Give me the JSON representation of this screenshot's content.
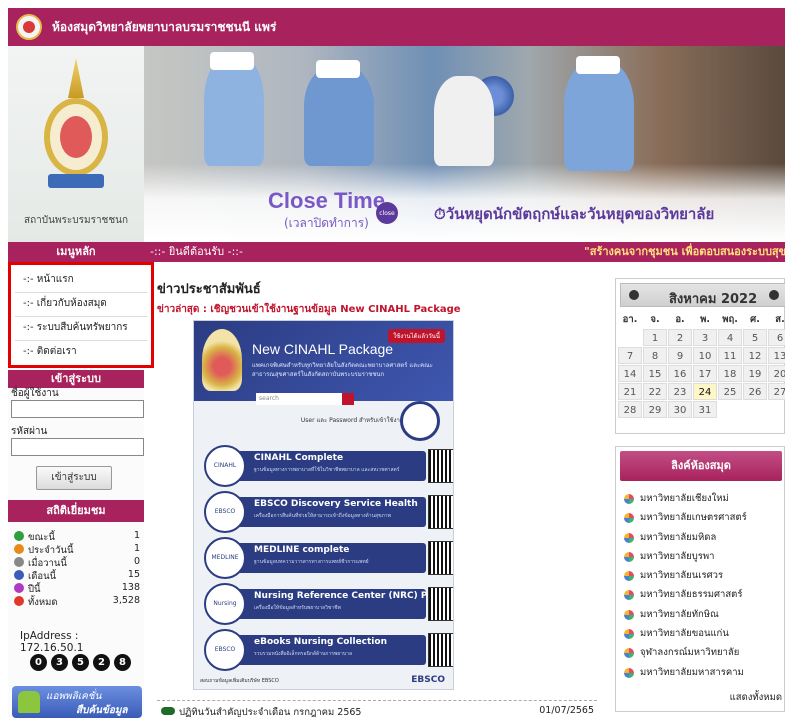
{
  "site": {
    "title": "ห้องสมุดวิทยาลัยพยาบาลบรมราชชนนี แพร่"
  },
  "banner": {
    "crest_caption": "สถาบันพระบรมราชชนก",
    "close_time": "Close Time",
    "close_time_sub": "(เวลาปิดทำการ)",
    "close_badge": "close",
    "holiday_text": "วันหยุดนักขัตฤกษ์และวันหยุดของวิทยาลัย"
  },
  "subbar": {
    "left_label": "เมนูหลัก",
    "welcome": "-::- ยินดีต้อนรับ -::-",
    "marquee": "\"สร้างคนจากชุมชน เพื่อตอบสนองระบบสุขภาพร"
  },
  "menu": {
    "items": [
      "-:- หน้าแรก",
      "-:- เกี่ยวกับห้องสมุด",
      "-:- ระบบสืบค้นทรัพยากร",
      "-:- ติดต่อเรา"
    ]
  },
  "login": {
    "header": "เข้าสู่ระบบ",
    "username_label": "ชื่อผู้ใช้งาน",
    "password_label": "รหัสผ่าน",
    "button": "เข้าสู่ระบบ"
  },
  "stats": {
    "header": "สถิติเยี่ยมชม",
    "rows": [
      {
        "label": "ขณะนี้",
        "value": "1",
        "color": "#2e9e3e"
      },
      {
        "label": "ประจำวันนี้",
        "value": "1",
        "color": "#e88a1a"
      },
      {
        "label": "เมื่อวานนี้",
        "value": "0",
        "color": "#888888"
      },
      {
        "label": "เดือนนี้",
        "value": "15",
        "color": "#3a5cb8"
      },
      {
        "label": "ปีนี้",
        "value": "138",
        "color": "#b23ac0"
      },
      {
        "label": "ทั้งหมด",
        "value": "3,528",
        "color": "#e0392a"
      }
    ],
    "ip": "IpAddress : 172.16.50.1",
    "counter": [
      "0",
      "3",
      "5",
      "2",
      "8"
    ]
  },
  "app_banner": {
    "line1": "แอพพลิเคชั่น",
    "line2": "สืบค้นข้อมูล"
  },
  "news": {
    "heading": "ข่าวประชาสัมพันธ์",
    "latest": "ข่าวล่าสุด : เชิญชวนเข้าใช้งานฐานข้อมูล New CINAHL Package",
    "poster": {
      "badge": "ใช้งานได้แล้ววันนี้",
      "title": "New CINAHL Package",
      "subtitle": "แพคเกจพิเศษสำหรับทุกวิทยาลัยในสังกัดคณะพยาบาลศาสตร์ และคณะสาธารณสุขศาสตร์ในสังกัดสถาบันพระบรมราชชนก",
      "search_placeholder": "search",
      "creds": "User และ Password สำหรับเข้าใช้งาน",
      "rows": [
        {
          "circle": "CINAHL",
          "name": "CINAHL Complete",
          "desc": "ฐานข้อมูลทางการพยาบาลที่ใช้ในวิชาชีพพยาบาล และสหเวชศาสตร์"
        },
        {
          "circle": "EBSCO",
          "name": "EBSCO Discovery Service Health",
          "desc": "เครื่องมือการสืบค้นที่ช่วยให้สามารถเข้าถึงข้อมูลทางด้านสุขภาพ"
        },
        {
          "circle": "MEDLINE",
          "name": "MEDLINE complete",
          "desc": "ฐานข้อมูลบทความวารสารทางการแพทย์ชีวการแพทย์"
        },
        {
          "circle": "Nursing",
          "name": "Nursing Reference Center (NRC) Plus",
          "desc": "เครื่องมือให้ข้อมูลสำหรับพยาบาลวิชาชีพ"
        },
        {
          "circle": "EBSCO",
          "name": "eBooks Nursing Collection",
          "desc": "รวบรวมหนังสืออิเล็กทรอนิกส์ด้านการพยาบาล"
        }
      ],
      "footer": "สอบถามข้อมูลเพิ่มเติมบริษัท EBSCO",
      "footer_logo": "EBSCO"
    },
    "item": {
      "text": "ปฏิทินวันสำคัญประจำเดือน กรกฎาคม 2565",
      "date": "01/07/2565"
    }
  },
  "calendar": {
    "month": "สิงหาคม 2022",
    "dow": [
      "อา.",
      "จ.",
      "อ.",
      "พ.",
      "พฤ.",
      "ศ.",
      "ส."
    ],
    "leading_blank": 1,
    "days_in_month": 31,
    "today": 24
  },
  "links": {
    "header": "ลิงค์ห้องสมุด",
    "items": [
      "มหาวิทยาลัยเชียงใหม่",
      "มหาวิทยาลัยเกษตรศาสตร์",
      "มหาวิทยาลัยมหิดล",
      "มหาวิทยาลัยบูรพา",
      "มหาวิทยาลัยนเรศวร",
      "มหาวิทยาลัยธรรมศาสตร์",
      "มหาวิทยาลัยทักษิณ",
      "มหาวิทยาลัยขอนแก่น",
      "จุฬาลงกรณ์มหาวิทยาลัย",
      "มหาวิทยาลัยมหาสารคาม"
    ],
    "more": "แสดงทั้งหมด"
  }
}
